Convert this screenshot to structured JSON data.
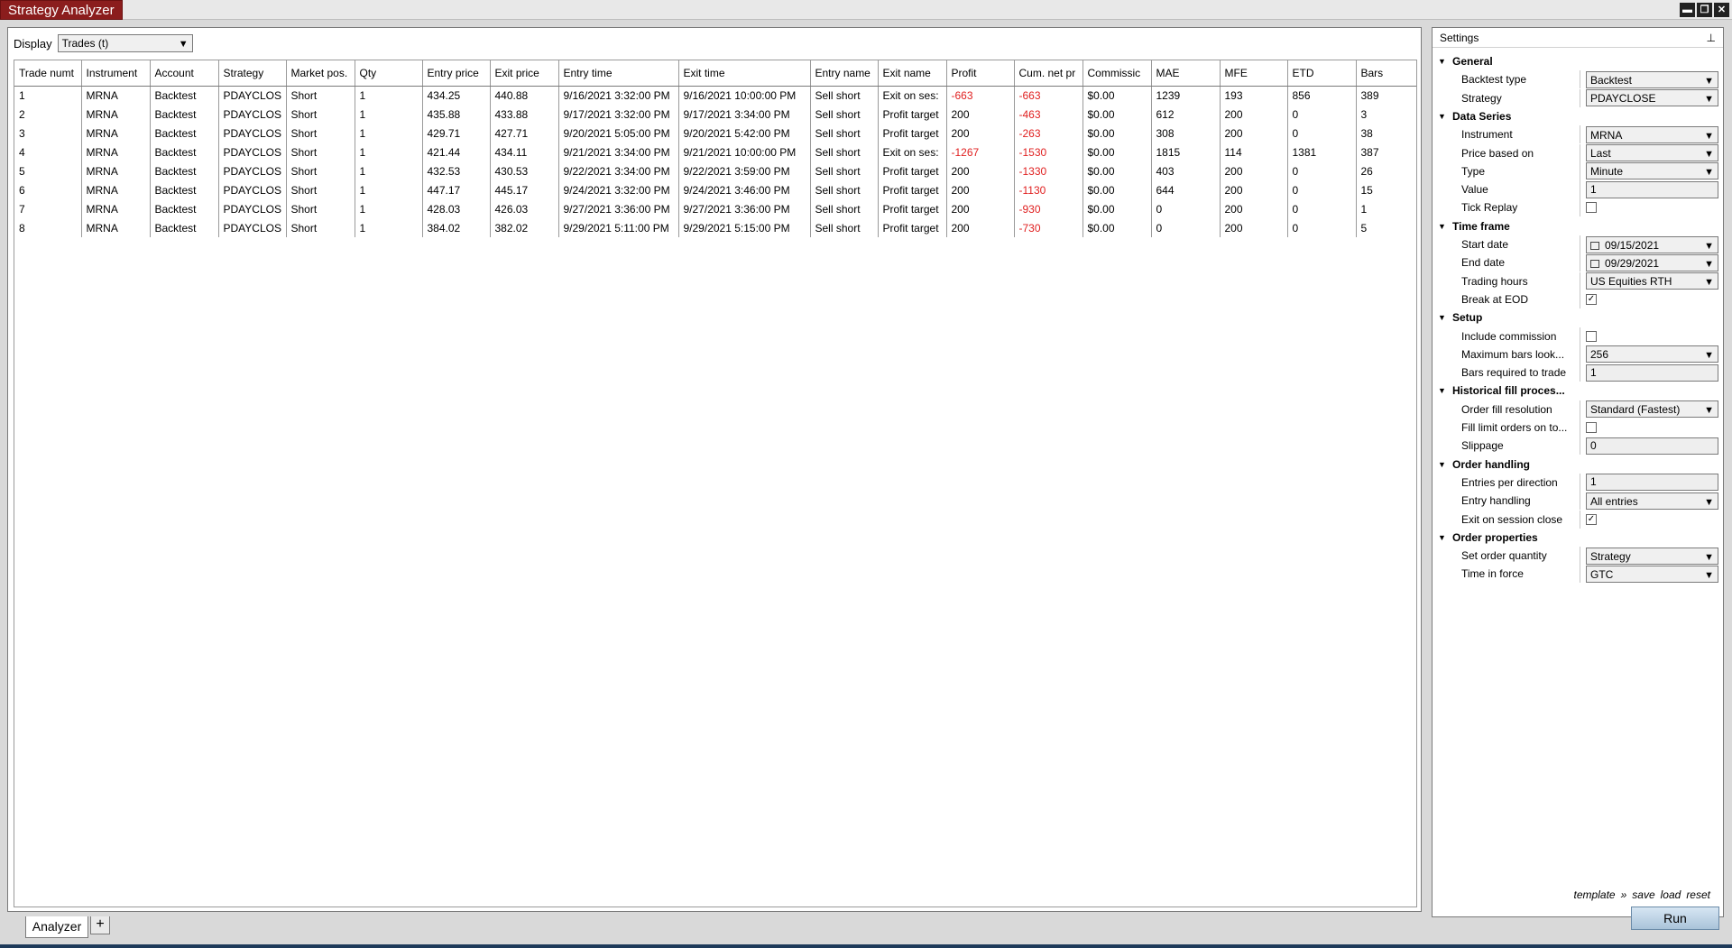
{
  "window": {
    "title": "Strategy Analyzer",
    "buttons": [
      "▬",
      "❐",
      "✕"
    ]
  },
  "display": {
    "label": "Display",
    "selected": "Trades (t)"
  },
  "trades": {
    "columns": [
      "Trade numt",
      "Instrument",
      "Account",
      "Strategy",
      "Market pos.",
      "Qty",
      "Entry price",
      "Exit price",
      "Entry time",
      "Exit time",
      "Entry name",
      "Exit name",
      "Profit",
      "Cum. net pr",
      "Commissic",
      "MAE",
      "MFE",
      "ETD",
      "Bars"
    ],
    "rows": [
      [
        "1",
        "MRNA",
        "Backtest",
        "PDAYCLOS",
        "Short",
        "1",
        "434.25",
        "440.88",
        "9/16/2021 3:32:00 PM",
        "9/16/2021 10:00:00 PM",
        "Sell short",
        "Exit on ses:",
        "-663",
        "-663",
        "$0.00",
        "1239",
        "193",
        "856",
        "389"
      ],
      [
        "2",
        "MRNA",
        "Backtest",
        "PDAYCLOS",
        "Short",
        "1",
        "435.88",
        "433.88",
        "9/17/2021 3:32:00 PM",
        "9/17/2021 3:34:00 PM",
        "Sell short",
        "Profit target",
        "200",
        "-463",
        "$0.00",
        "612",
        "200",
        "0",
        "3"
      ],
      [
        "3",
        "MRNA",
        "Backtest",
        "PDAYCLOS",
        "Short",
        "1",
        "429.71",
        "427.71",
        "9/20/2021 5:05:00 PM",
        "9/20/2021 5:42:00 PM",
        "Sell short",
        "Profit target",
        "200",
        "-263",
        "$0.00",
        "308",
        "200",
        "0",
        "38"
      ],
      [
        "4",
        "MRNA",
        "Backtest",
        "PDAYCLOS",
        "Short",
        "1",
        "421.44",
        "434.11",
        "9/21/2021 3:34:00 PM",
        "9/21/2021 10:00:00 PM",
        "Sell short",
        "Exit on ses:",
        "-1267",
        "-1530",
        "$0.00",
        "1815",
        "114",
        "1381",
        "387"
      ],
      [
        "5",
        "MRNA",
        "Backtest",
        "PDAYCLOS",
        "Short",
        "1",
        "432.53",
        "430.53",
        "9/22/2021 3:34:00 PM",
        "9/22/2021 3:59:00 PM",
        "Sell short",
        "Profit target",
        "200",
        "-1330",
        "$0.00",
        "403",
        "200",
        "0",
        "26"
      ],
      [
        "6",
        "MRNA",
        "Backtest",
        "PDAYCLOS",
        "Short",
        "1",
        "447.17",
        "445.17",
        "9/24/2021 3:32:00 PM",
        "9/24/2021 3:46:00 PM",
        "Sell short",
        "Profit target",
        "200",
        "-1130",
        "$0.00",
        "644",
        "200",
        "0",
        "15"
      ],
      [
        "7",
        "MRNA",
        "Backtest",
        "PDAYCLOS",
        "Short",
        "1",
        "428.03",
        "426.03",
        "9/27/2021 3:36:00 PM",
        "9/27/2021 3:36:00 PM",
        "Sell short",
        "Profit target",
        "200",
        "-930",
        "$0.00",
        "0",
        "200",
        "0",
        "1"
      ],
      [
        "8",
        "MRNA",
        "Backtest",
        "PDAYCLOS",
        "Short",
        "1",
        "384.02",
        "382.02",
        "9/29/2021 5:11:00 PM",
        "9/29/2021 5:15:00 PM",
        "Sell short",
        "Profit target",
        "200",
        "-730",
        "$0.00",
        "0",
        "200",
        "0",
        "5"
      ]
    ]
  },
  "bottom_tabs": {
    "active": "Analyzer",
    "add": "+"
  },
  "settings": {
    "title": "Settings",
    "pin": "⊥",
    "sections": [
      {
        "title": "General",
        "props": [
          {
            "label": "Backtest type",
            "type": "select",
            "value": "Backtest"
          },
          {
            "label": "Strategy",
            "type": "select",
            "value": "PDAYCLOSE"
          }
        ]
      },
      {
        "title": "Data Series",
        "props": [
          {
            "label": "Instrument",
            "type": "select",
            "value": "MRNA"
          },
          {
            "label": "Price based on",
            "type": "select",
            "value": "Last"
          },
          {
            "label": "Type",
            "type": "select",
            "value": "Minute"
          },
          {
            "label": "Value",
            "type": "input",
            "value": "1"
          },
          {
            "label": "Tick Replay",
            "type": "checkbox",
            "value": ""
          }
        ]
      },
      {
        "title": "Time frame",
        "props": [
          {
            "label": "Start date",
            "type": "date",
            "value": "09/15/2021"
          },
          {
            "label": "End date",
            "type": "date",
            "value": "09/29/2021"
          },
          {
            "label": "Trading hours",
            "type": "select",
            "value": "US Equities RTH"
          },
          {
            "label": "Break at EOD",
            "type": "checkbox",
            "value": "✓"
          }
        ]
      },
      {
        "title": "Setup",
        "props": [
          {
            "label": "Include commission",
            "type": "checkbox",
            "value": ""
          },
          {
            "label": "Maximum bars look...",
            "type": "select",
            "value": "256"
          },
          {
            "label": "Bars required to trade",
            "type": "input",
            "value": "1"
          }
        ]
      },
      {
        "title": "Historical fill proces...",
        "props": [
          {
            "label": "Order fill resolution",
            "type": "select",
            "value": "Standard (Fastest)"
          },
          {
            "label": "Fill limit orders on to...",
            "type": "checkbox",
            "value": ""
          },
          {
            "label": "Slippage",
            "type": "input",
            "value": "0"
          }
        ]
      },
      {
        "title": "Order handling",
        "props": [
          {
            "label": "Entries per direction",
            "type": "input",
            "value": "1"
          },
          {
            "label": "Entry handling",
            "type": "select",
            "value": "All entries"
          },
          {
            "label": "Exit on session close",
            "type": "checkbox",
            "value": "✓"
          }
        ]
      },
      {
        "title": "Order properties",
        "props": [
          {
            "label": "Set order quantity",
            "type": "select",
            "value": "Strategy"
          },
          {
            "label": "Time in force",
            "type": "select",
            "value": "GTC"
          }
        ]
      }
    ],
    "template_links": {
      "template": "template",
      "sep": "»",
      "save": "save",
      "load": "load",
      "reset": "reset"
    },
    "run_label": "Run"
  },
  "colors": {
    "title_accent": "#8b1d1d",
    "negative": "#e02020",
    "run_button": "#a9c3d9"
  }
}
